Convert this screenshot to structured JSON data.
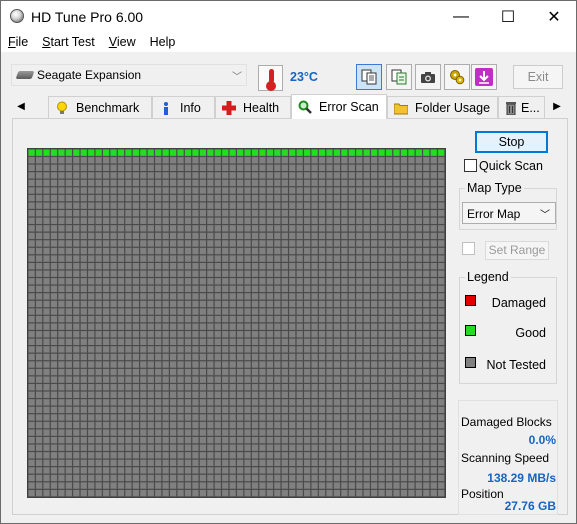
{
  "window": {
    "title": "HD Tune Pro 6.00",
    "controls": {
      "minimize": "—",
      "maximize": "☐",
      "close": "✕"
    }
  },
  "menu": {
    "items": [
      {
        "label": "File",
        "mnemonic": "F",
        "rest": "ile"
      },
      {
        "label": "Start Test",
        "mnemonic": "S",
        "rest": "tart Test"
      },
      {
        "label": "View",
        "mnemonic": "V",
        "rest": "iew"
      },
      {
        "label": "Help",
        "mnemonic": "",
        "rest": "Help"
      }
    ]
  },
  "toolbar": {
    "drive": "Seagate Expansion",
    "temperature": "23°C",
    "exit_label": "Exit"
  },
  "tabs": [
    {
      "label": "Benchmark",
      "icon": "lightbulb-icon"
    },
    {
      "label": "Info",
      "icon": "info-icon"
    },
    {
      "label": "Health",
      "icon": "health-cross-icon"
    },
    {
      "label": "Error Scan",
      "icon": "magnifier-icon",
      "active": true
    },
    {
      "label": "Folder Usage",
      "icon": "folder-icon"
    },
    {
      "label": "E...",
      "icon": "trash-icon"
    }
  ],
  "scan": {
    "stop_label": "Stop",
    "quick_scan_label": "Quick Scan",
    "quick_scan_checked": false,
    "map_type_title": "Map Type",
    "map_type_value": "Error Map",
    "set_range_label": "Set Range",
    "set_range_checked": false
  },
  "legend": {
    "title": "Legend",
    "items": [
      {
        "label": "Damaged",
        "color": "#e00000"
      },
      {
        "label": "Good",
        "color": "#22dd22"
      },
      {
        "label": "Not Tested",
        "color": "#808080"
      }
    ]
  },
  "stats": {
    "damaged_blocks_label": "Damaged Blocks",
    "damaged_blocks_value": "0.0%",
    "scanning_speed_label": "Scanning Speed",
    "scanning_speed_value": "138.29 MB/s",
    "position_label": "Position",
    "position_value": "27.76 GB"
  },
  "error_map": {
    "columns": 56,
    "rows": 46,
    "good_rows": 1,
    "colors": {
      "good": "#22dd22",
      "not_tested": "#808080",
      "grid": "#4a4a4a"
    }
  }
}
